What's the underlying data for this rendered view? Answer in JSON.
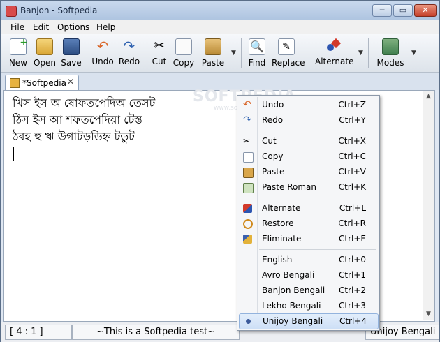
{
  "window": {
    "title": "Banjon - Softpedia",
    "minimize": "─",
    "maximize": "▭",
    "close": "✕"
  },
  "menubar": {
    "items": [
      "File",
      "Edit",
      "Options",
      "Help"
    ]
  },
  "toolbar": {
    "new": "New",
    "open": "Open",
    "save": "Save",
    "undo": "Undo",
    "redo": "Redo",
    "cut": "Cut",
    "copy": "Copy",
    "paste": "Paste",
    "find": "Find",
    "replace": "Replace",
    "alternate": "Alternate",
    "modes": "Modes",
    "dropdown_glyph": "▼"
  },
  "tab": {
    "label": "*Softpedia",
    "close": "✕"
  },
  "editor": {
    "lines": [
      "খিস ইস অ ষোফতপেদিঅ তেসট",
      "ঠিস ইস আ শফতপেদিয়া টেস্ত",
      "ঠবহ হু ঋ উগাটড়ডিহ্ন টডুট"
    ],
    "watermark": "SOFTPEDIA",
    "watermark_url": "www.softpedia.com"
  },
  "statusbar": {
    "position": "[ 4 : 1 ]",
    "message": "~This is a Softpedia test~",
    "mode": "Unijoy Bengali"
  },
  "context_menu": {
    "items": [
      {
        "label": "Undo",
        "shortcut": "Ctrl+Z",
        "icon": "undo-icon"
      },
      {
        "label": "Redo",
        "shortcut": "Ctrl+Y",
        "icon": "redo-icon"
      },
      {
        "label": "Cut",
        "shortcut": "Ctrl+X",
        "icon": "cut-icon"
      },
      {
        "label": "Copy",
        "shortcut": "Ctrl+C",
        "icon": "copy-icon"
      },
      {
        "label": "Paste",
        "shortcut": "Ctrl+V",
        "icon": "paste-icon"
      },
      {
        "label": "Paste Roman",
        "shortcut": "Ctrl+K",
        "icon": "paste-roman-icon"
      },
      {
        "label": "Alternate",
        "shortcut": "Ctrl+L",
        "icon": "alternate-icon"
      },
      {
        "label": "Restore",
        "shortcut": "Ctrl+R",
        "icon": "restore-icon"
      },
      {
        "label": "Eliminate",
        "shortcut": "Ctrl+E",
        "icon": "eliminate-icon"
      },
      {
        "label": "English",
        "shortcut": "Ctrl+0"
      },
      {
        "label": "Avro Bengali",
        "shortcut": "Ctrl+1"
      },
      {
        "label": "Banjon Bengali",
        "shortcut": "Ctrl+2"
      },
      {
        "label": "Lekho Bengali",
        "shortcut": "Ctrl+3"
      },
      {
        "label": "Unijoy Bengali",
        "shortcut": "Ctrl+4",
        "selected": true
      }
    ]
  }
}
